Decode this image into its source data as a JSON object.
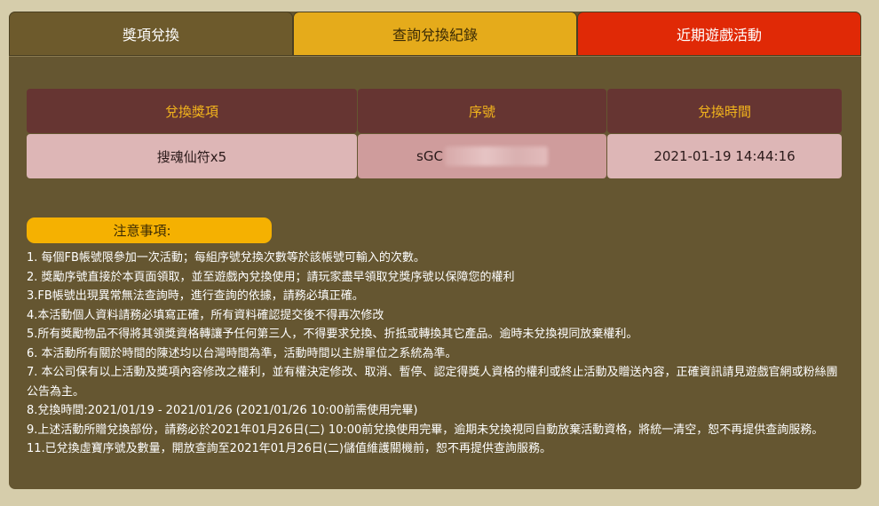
{
  "tabs": [
    {
      "label": "獎項兌換"
    },
    {
      "label": "查詢兌換紀錄"
    },
    {
      "label": "近期遊戲活動"
    }
  ],
  "table": {
    "headers": [
      "兌換獎項",
      "序號",
      "兌換時間"
    ],
    "rows": [
      {
        "prize": "搜魂仙符x5",
        "serial_prefix": "sGC",
        "time": "2021-01-19 14:44:16"
      }
    ]
  },
  "notice": {
    "title": "注意事項:",
    "items": [
      "1. 每個FB帳號限參加一次活動；每組序號兌換次數等於該帳號可輸入的次數。",
      "2. 獎勵序號直接於本頁面領取，並至遊戲內兌換使用；請玩家盡早領取兌獎序號以保障您的權利",
      "3.FB帳號出現異常無法查詢時，進行查詢的依據，請務必填正確。",
      "4.本活動個人資料請務必填寫正確，所有資料確認提交後不得再次修改",
      "5.所有獎勵物品不得將其領獎資格轉讓予任何第三人，不得要求兌換、折抵或轉換其它產品。逾時未兌換視同放棄權利。",
      "6. 本活動所有關於時間的陳述均以台灣時間為準，活動時間以主辦單位之系統為準。",
      "7. 本公司保有以上活動及獎項內容修改之權利，並有權決定修改、取消、暫停、認定得獎人資格的權利或終止活動及贈送內容，正確資訊請見遊戲官網或粉絲團公告為主。",
      "8.兌換時間:2021/01/19 - 2021/01/26 (2021/01/26 10:00前需使用完畢)",
      "9.上述活動所贈兌換部份，請務必於2021年01月26日(二) 10:00前兌換使用完畢，逾期未兌換視同自動放棄活動資格，將統一清空，恕不再提供查詢服務。",
      "11.已兌換虛寶序號及數量，開放查詢至2021年01月26日(二)儲值維護關機前，恕不再提供查詢服務。"
    ]
  },
  "colors": {
    "page_bg": "#d6cdab",
    "panel_bg": "#655631",
    "tab_active_red": "#e02906",
    "tab_gold": "#e5ab1b",
    "header_cell": "#663532",
    "header_text": "#f3b51c",
    "data_cell": "#ddb6b6",
    "notice_badge": "#f5b101"
  }
}
